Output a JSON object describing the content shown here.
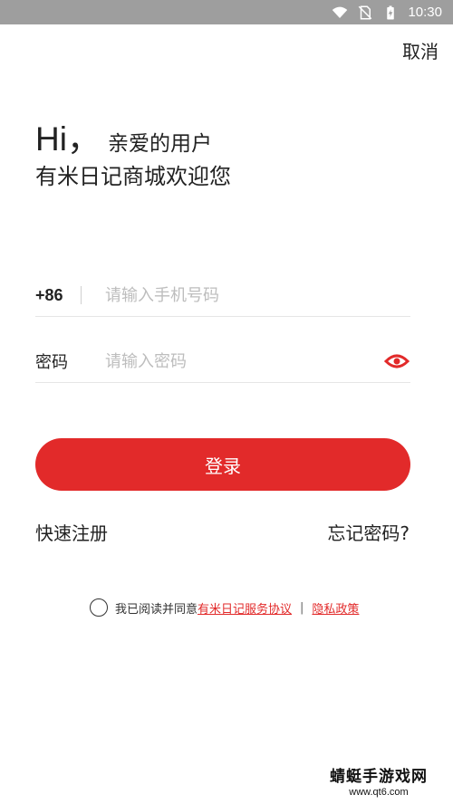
{
  "status_bar": {
    "time": "10:30",
    "icons": [
      "wifi-icon",
      "no-sim-icon",
      "battery-charging-icon"
    ]
  },
  "header": {
    "cancel_label": "取消"
  },
  "greeting": {
    "hi": "Hi，",
    "sub": "亲爱的用户",
    "welcome": "有米日记商城欢迎您"
  },
  "form": {
    "phone": {
      "country_code": "+86",
      "placeholder": "请输入手机号码",
      "value": ""
    },
    "password": {
      "label": "密码",
      "placeholder": "请输入密码",
      "value": "",
      "toggle_icon": "eye-icon"
    }
  },
  "actions": {
    "login_label": "登录",
    "register_label": "快速注册",
    "forgot_label": "忘记密码?"
  },
  "agreement": {
    "checked": false,
    "prefix": "我已阅读并同意",
    "service_link": "有米日记服务协议",
    "separator": "|",
    "privacy_link": "隐私政策"
  },
  "watermark": {
    "text": "蜻蜓手游戏网",
    "url": "www.qt6.com"
  },
  "colors": {
    "accent": "#e22a2a",
    "status_bar": "#9e9e9e",
    "text": "#222222",
    "placeholder": "#bdbdbd"
  }
}
